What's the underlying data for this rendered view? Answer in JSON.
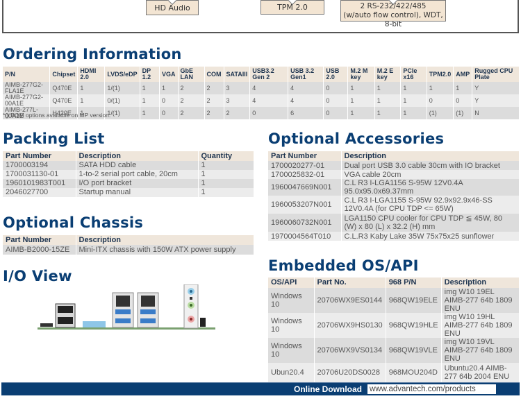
{
  "diagram": {
    "boxes": {
      "audio": "HD Audio",
      "tpm": "TPM 2.0",
      "serial_line1": "2 RS-232/422/485",
      "serial_line2": "(w/auto flow control), WDT, 8-bit"
    }
  },
  "ordering": {
    "title": "Ordering Information",
    "headers": [
      "P/N",
      "Chipset",
      "HDMI 2.0",
      "LVDS/eDP",
      "DP 1.2",
      "VGA",
      "GbE LAN",
      "COM",
      "SATAIII",
      "USB3.2 Gen 2",
      "USB 3.2 Gen1",
      "USB 2.0",
      "M.2 M key",
      "M.2 E key",
      "PCIe x16",
      "TPM2.0",
      "AMP",
      "Rugged CPU Plate"
    ],
    "rows": [
      [
        "AIMB-277G2-FLA1E",
        "Q470E",
        "1",
        "1/(1)",
        "1",
        "1",
        "2",
        "2",
        "3",
        "4",
        "4",
        "0",
        "1",
        "1",
        "1",
        "1",
        "1",
        "Y"
      ],
      [
        "AIMB-277G2-00A1E",
        "Q470E",
        "1",
        "0/(1)",
        "1",
        "0",
        "2",
        "2",
        "3",
        "4",
        "4",
        "0",
        "1",
        "1",
        "1",
        "0",
        "0",
        "Y"
      ],
      [
        "AIMB-277L-00A1E",
        "H420E",
        "1",
        "1/(1)",
        "1",
        "0",
        "2",
        "2",
        "2",
        "0",
        "6",
        "0",
        "1",
        "1",
        "1",
        "(1)",
        "(1)",
        "N"
      ]
    ],
    "note": "*() BOM options available on MP version."
  },
  "packing": {
    "title": "Packing List",
    "headers": [
      "Part Number",
      "Description",
      "Quantity"
    ],
    "rows": [
      [
        "1700003194",
        "SATA HDD cable",
        "1"
      ],
      [
        "1700031130-01",
        "1-to-2 serial port cable, 20cm",
        "1"
      ],
      [
        "1960101983T001",
        "I/O port bracket",
        "1"
      ],
      [
        "2046027700",
        "Startup manual",
        "1"
      ]
    ]
  },
  "chassis": {
    "title": "Optional Chassis",
    "headers": [
      "Part Number",
      "Description"
    ],
    "rows": [
      [
        "AIMB-B2000-15ZE",
        "Mini-ITX chassis with 150W ATX power supply"
      ]
    ]
  },
  "io_view": {
    "title": "I/O View"
  },
  "accessories": {
    "title": "Optional Accessories",
    "headers": [
      "Part Number",
      "Description"
    ],
    "rows": [
      [
        "1700020277-01",
        "Dual port USB 3.0 cable 30cm with IO bracket"
      ],
      [
        "1700025832-01",
        "VGA cable 20cm"
      ],
      [
        "1960047669N001",
        "C.L R3 I-LGA1156 S-95W 12V0.4A 95.0x95.0x69.37mm"
      ],
      [
        "1960053207N001",
        "C.L R3 I-LGA1155 S-95W 92.9x92.9x46-SS 12V0.4A (for CPU TDP <= 65W)"
      ],
      [
        "1960060732N001",
        "LGA1150 CPU cooler for CPU TDP ≦ 45W, 80 (W) x 80 (L) x 32.2 (H) mm"
      ],
      [
        "1970004564T010",
        "C.L.R3 Kaby Lake 35W 75x75x25 sunflower"
      ]
    ]
  },
  "os": {
    "title": "Embedded OS/API",
    "headers": [
      "OS/API",
      "Part No.",
      "968 P/N",
      "Description"
    ],
    "rows": [
      [
        "Windows 10",
        "20706WX9ES0144",
        "968QW19ELE",
        "img W10 19EL AIMB-277 64b 1809 ENU"
      ],
      [
        "Windows 10",
        "20706WX9HS0130",
        "968QW19HLE",
        "img W10 19HL AIMB-277 64b 1809 ENU"
      ],
      [
        "Windows 10",
        "20706WX9VS0134",
        "968QW19VLE",
        "img W10 19VL AIMB-277 64b 1809 ENU"
      ],
      [
        "Ubun20.4",
        "20706U20DS0028",
        "968MOU204D",
        "Ubuntu20.4 AIMB-277 64b 2004 ENU"
      ]
    ]
  },
  "footer": {
    "label": "Online Download",
    "url": "www.advantech.com/products"
  },
  "colors": {
    "heading": "#0a3e73",
    "header_bg": "#efe6db",
    "row_dark": "#dcdcdc",
    "row_light": "#ececec",
    "footer_bg": "#0a3e73"
  }
}
